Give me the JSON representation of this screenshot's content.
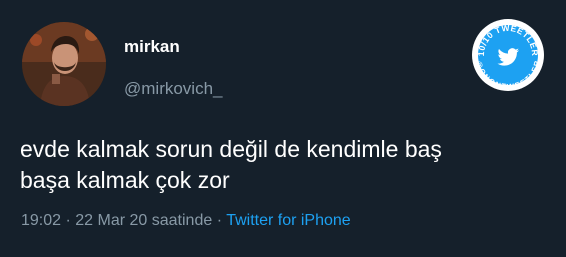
{
  "user": {
    "display_name": "mirkan",
    "handle": "@mirkovich_",
    "avatar_icon": "profile-photo"
  },
  "tweet": {
    "lines": [
      "evde kalmak sorun değil de kendimle baş",
      "başa kalmak çok zor"
    ]
  },
  "meta": {
    "time": "19:02",
    "separator": " · ",
    "date": "22 Mar 20 saatinde",
    "separator2": " · ",
    "source": "Twitter for iPhone"
  },
  "badge": {
    "top_text": "10/10 TWEETLER",
    "bottom_text": "@ONONTWEETLER",
    "icon": "twitter-bird-icon",
    "color": "#1da1f2"
  },
  "colors": {
    "background": "#15202b",
    "secondary_text": "#8899a6",
    "link": "#1da1f2"
  }
}
